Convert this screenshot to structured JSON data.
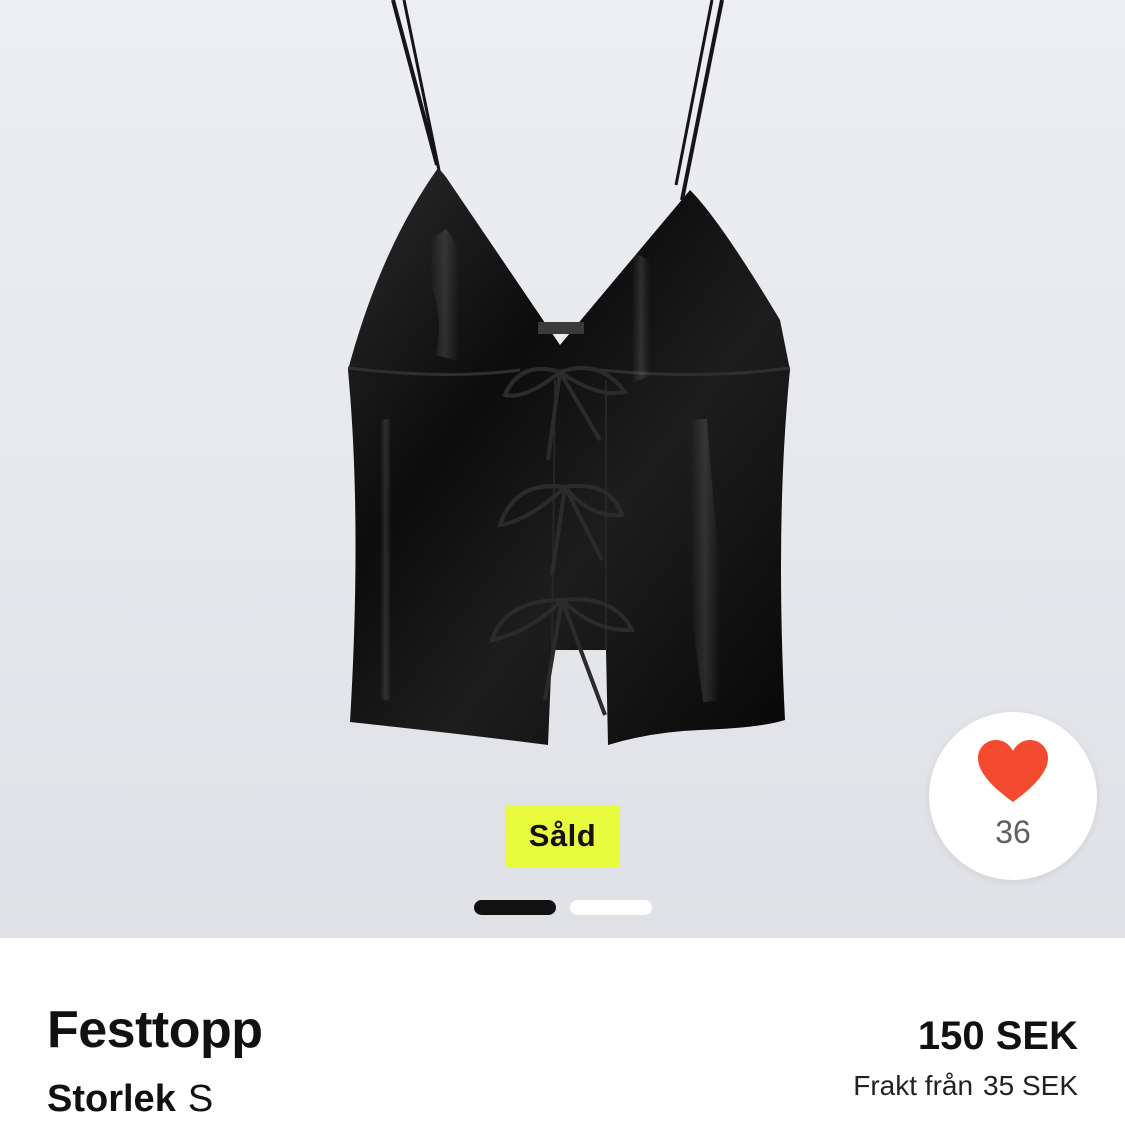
{
  "listing": {
    "status_badge": "Såld",
    "image_dots": {
      "count": 2,
      "active_index": 0
    },
    "likes": {
      "count": "36",
      "icon": "heart-icon"
    },
    "title": "Festtopp",
    "size_label": "Storlek",
    "size_value": "S",
    "price": "150 SEK",
    "shipping_label": "Frakt från",
    "shipping_amount": "35 SEK"
  },
  "colors": {
    "sold_badge_bg": "#e8fb3d",
    "heart": "#f44a2f",
    "text": "#111111",
    "muted_text": "#5f5f5f"
  }
}
